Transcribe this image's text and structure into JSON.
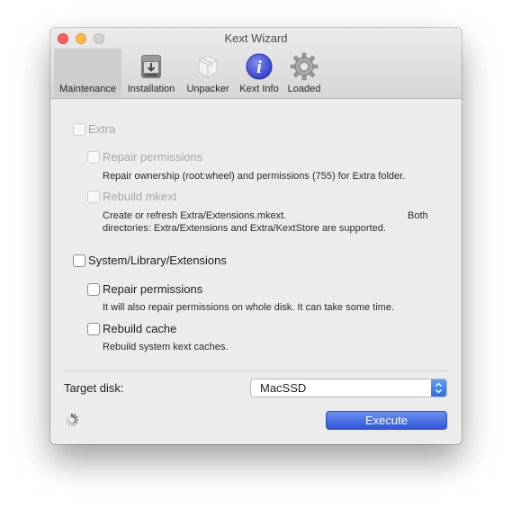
{
  "window": {
    "title": "Kext Wizard"
  },
  "toolbar": {
    "items": [
      {
        "label": "Maintenance",
        "icon": "maintenance-icon"
      },
      {
        "label": "Installation",
        "icon": "installation-icon"
      },
      {
        "label": "Unpacker",
        "icon": "unpacker-icon"
      },
      {
        "label": "Kext Info",
        "icon": "info-icon"
      },
      {
        "label": "Loaded",
        "icon": "gear-icon"
      }
    ],
    "active": "Maintenance"
  },
  "extra": {
    "label": "Extra",
    "checked": false,
    "enabled": false,
    "repair": {
      "label": "Repair permissions",
      "checked": false,
      "description": "Repair ownership (root:wheel) and permissions (755) for Extra folder."
    },
    "rebuild": {
      "label": "Rebuild mkext",
      "checked": false,
      "description_line1_left": "Create or refresh Extra/Extensions.mkext.",
      "description_line1_right": "Both",
      "description_line2": "directories: Extra/Extensions and Extra/KextStore are supported."
    }
  },
  "system": {
    "label": "System/Library/Extensions",
    "checked": false,
    "repair": {
      "label": "Repair permissions",
      "checked": false,
      "description": "It will also repair permissions on whole disk. It can take some time."
    },
    "rebuild": {
      "label": "Rebuild cache",
      "checked": false,
      "description": "Rebuild system kext caches."
    }
  },
  "target": {
    "label": "Target disk:",
    "value": "MacSSD"
  },
  "execute_label": "Execute",
  "colors": {
    "accent": "#3a63e0",
    "popup_arrow": "#2b6fe9",
    "close": "#fc605c",
    "minimize": "#fdbc40",
    "zoom_disabled": "#d2d2d2"
  }
}
